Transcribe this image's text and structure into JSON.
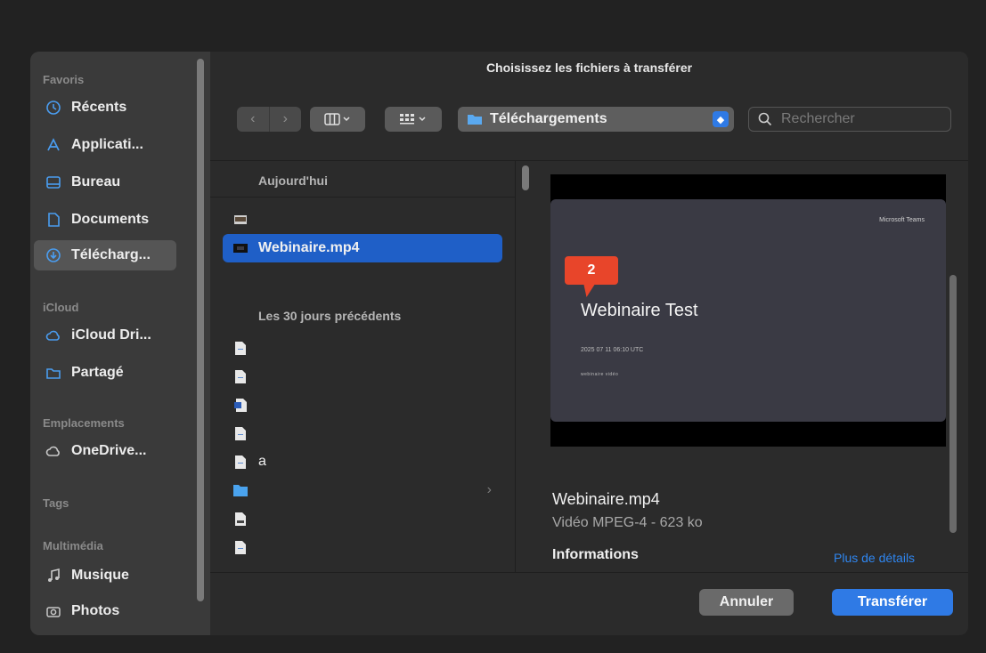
{
  "dialog": {
    "title": "Choisissez les fichiers à transférer"
  },
  "sidebar": {
    "sections": [
      {
        "label": "Favoris"
      },
      {
        "label": "iCloud"
      },
      {
        "label": "Emplacements"
      },
      {
        "label": "Tags"
      },
      {
        "label": "Multimédia"
      }
    ],
    "items": [
      {
        "label": "Récents",
        "icon": "clock-icon"
      },
      {
        "label": "Applicati...",
        "icon": "apps-icon"
      },
      {
        "label": "Bureau",
        "icon": "desktop-icon"
      },
      {
        "label": "Documents",
        "icon": "document-icon"
      },
      {
        "label": "Télécharg...",
        "icon": "download-icon",
        "active": true
      },
      {
        "label": "iCloud Dri...",
        "icon": "cloud-icon"
      },
      {
        "label": "Partagé",
        "icon": "shared-folder-icon"
      },
      {
        "label": "OneDrive...",
        "icon": "cloud-icon"
      },
      {
        "label": "Musique",
        "icon": "music-note-icon"
      },
      {
        "label": "Photos",
        "icon": "camera-icon"
      }
    ]
  },
  "toolbar": {
    "location": "Téléchargements",
    "search_placeholder": "Rechercher"
  },
  "file_list": {
    "groups": [
      {
        "header": "Aujourd'hui"
      },
      {
        "header": "Les 30 jours précédents"
      }
    ],
    "today": [
      {
        "name": "",
        "icon": "image-thumbnail-icon"
      },
      {
        "name": "Webinaire.mp4",
        "icon": "video-thumbnail-icon",
        "selected": true
      }
    ],
    "previous": [
      {
        "name": "",
        "icon": "text-document-icon"
      },
      {
        "name": "",
        "icon": "text-document-icon"
      },
      {
        "name": "",
        "icon": "word-document-icon"
      },
      {
        "name": "",
        "icon": "text-document-icon"
      },
      {
        "name": "a",
        "icon": "text-document-icon"
      },
      {
        "name": "",
        "icon": "folder-icon"
      },
      {
        "name": "",
        "icon": "plain-document-icon"
      },
      {
        "name": "",
        "icon": "text-document-icon"
      }
    ]
  },
  "annotation": {
    "badge": "2"
  },
  "preview": {
    "slide_brand": "Microsoft Teams",
    "slide_title": "Webinaire Test",
    "slide_date": "2025 07 11 06:10 UTC",
    "slide_line": "webinaire vidéo",
    "file_name": "Webinaire.mp4",
    "file_type": "Vidéo MPEG-4 - 623 ko",
    "info_heading": "Informations",
    "more_link": "Plus de détails"
  },
  "buttons": {
    "cancel": "Annuler",
    "confirm": "Transférer"
  },
  "colors": {
    "accent": "#2f7ae5",
    "selection": "#1f5fc7",
    "badge": "#e8452a"
  }
}
